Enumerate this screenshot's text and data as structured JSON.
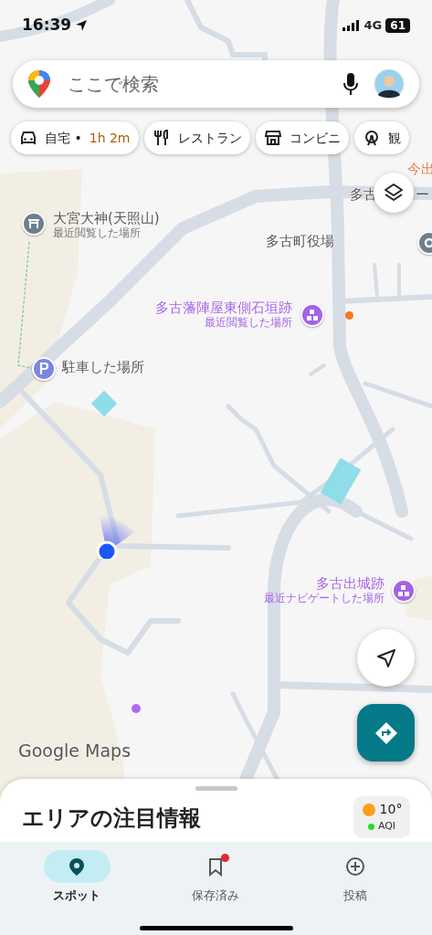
{
  "status_bar": {
    "time": "16:39",
    "network": "4G",
    "battery": "61"
  },
  "search": {
    "placeholder": "ここで検索"
  },
  "chips": [
    {
      "kind": "car",
      "label": "自宅 •",
      "detail": "1h 2m"
    },
    {
      "kind": "restaurant",
      "label": "レストラン"
    },
    {
      "kind": "store",
      "label": "コンビニ"
    },
    {
      "kind": "sights",
      "label": "観"
    }
  ],
  "map_labels": [
    {
      "kind": "area",
      "text": "今出"
    },
    {
      "kind": "road",
      "text": "多古"
    },
    {
      "kind": "road",
      "text": "ー"
    }
  ],
  "places": [
    {
      "kind": "shrine",
      "name": "大宮大神(天照山)",
      "note": "最近閲覧した場所",
      "color": "#6c7f8c"
    },
    {
      "kind": "office",
      "name": "多古町役場",
      "color": "#6c7f8c"
    },
    {
      "kind": "historic",
      "name": "多古藩陣屋東側石垣跡",
      "note": "最近閲覧した場所",
      "color": "#a463e6"
    },
    {
      "kind": "parking",
      "name": "駐車した場所",
      "color": "#7b86e0"
    },
    {
      "kind": "historic",
      "name": "多古出城跡",
      "note": "最近ナビゲートした場所",
      "color": "#a463e6"
    }
  ],
  "logo": "Google Maps",
  "sheet": {
    "title": "エリアの注目情報",
    "weather": {
      "temperature": "10°",
      "aqi": {
        "label": "AQI",
        "color": "#22dd22"
      }
    }
  },
  "nav": [
    {
      "kind": "spot",
      "label": "スポット",
      "selected": true,
      "badge": false
    },
    {
      "kind": "saved",
      "label": "保存済み",
      "selected": false,
      "badge": true
    },
    {
      "kind": "post",
      "label": "投稿",
      "selected": false,
      "badge": false
    }
  ]
}
